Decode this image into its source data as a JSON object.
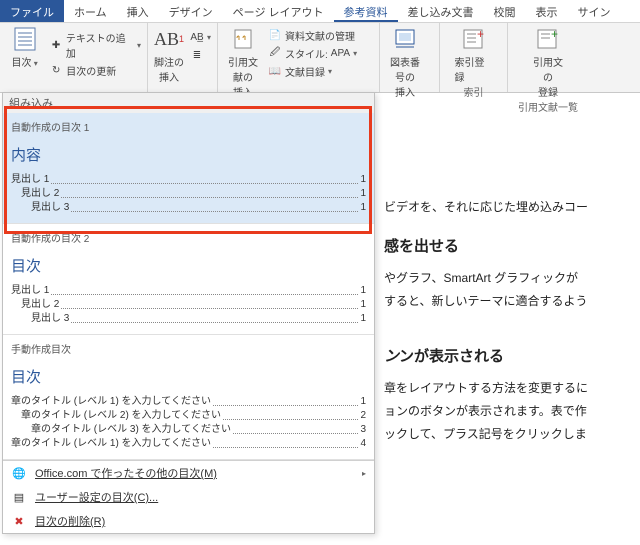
{
  "tabs": {
    "file": "ファイル",
    "home": "ホーム",
    "insert": "挿入",
    "design": "デザイン",
    "layout": "ページ レイアウト",
    "references": "参考資料",
    "mailings": "差し込み文書",
    "review": "校閲",
    "view": "表示",
    "signin": "サイン"
  },
  "ribbon": {
    "toc": {
      "label": "目次",
      "add_text": "テキストの追加",
      "update": "目次の更新"
    },
    "footnote": {
      "insert": "脚注の\n挿入",
      "ab": "AB"
    },
    "citation": {
      "insert": "引用文献の\n挿入",
      "manage": "資料文献の管理",
      "style_label": "スタイル:",
      "style_value": "APA",
      "biblio": "文献目録"
    },
    "caption": {
      "insert": "図表番号の\n挿入"
    },
    "index": {
      "mark": "索引登録",
      "group_lbl": "索引"
    },
    "toa": {
      "mark": "引用文の\n登録",
      "group_lbl": "引用文献一覧"
    }
  },
  "panel": {
    "builtin": "組み込み",
    "auto1": {
      "title": "自動作成の目次 1",
      "heading": "内容",
      "h1": "見出し 1",
      "h2": "見出し 2",
      "h3": "見出し 3",
      "p": "1"
    },
    "auto2": {
      "title": "自動作成の目次 2",
      "heading": "目次",
      "h1": "見出し 1",
      "h2": "見出し 2",
      "h3": "見出し 3",
      "p": "1"
    },
    "manual": {
      "title": "手動作成目次",
      "heading": "目次",
      "l1": "章のタイトル (レベル 1) を入力してください",
      "l2": "章のタイトル (レベル 2) を入力してください",
      "l3": "章のタイトル (レベル 3) を入力してください",
      "l1b": "章のタイトル (レベル 1) を入力してください",
      "p1": "1",
      "p2": "2",
      "p3": "3",
      "p4": "4"
    },
    "menu": {
      "office": "Office.com で作ったその他の目次(M)",
      "custom": "ユーザー設定の目次(C)...",
      "remove": "目次の削除(R)"
    }
  },
  "doc": {
    "p1": "ビデオを、それに応じた埋め込みコー",
    "h2": "感を出せる",
    "p2": "やグラフ、SmartArt グラフィックが",
    "p3": "すると、新しいテーマに適合するよう",
    "h3": "ンが表示される",
    "p4": "章をレイアウトする方法を変更するに",
    "p5": "ョンのボタンが表示されます。表で作",
    "p6": "ックして、プラス記号をクリックしま"
  }
}
